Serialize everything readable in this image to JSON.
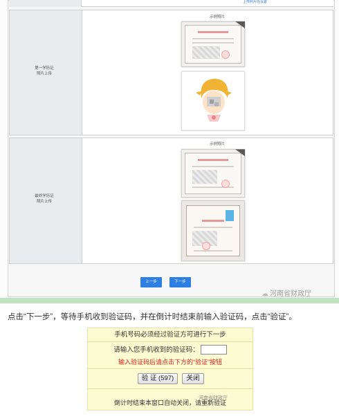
{
  "top_fragment": {
    "link": "上传照片任设置"
  },
  "section1": {
    "label_line1": "第一学历证",
    "label_line2": "照片上传",
    "caption": "示例照片"
  },
  "section2": {
    "label_line1": "最终学历证",
    "label_line2": "照片上传",
    "caption": "示例照片"
  },
  "nav": {
    "prev": "上一步",
    "next": "下一步"
  },
  "watermark": "河南省财政厅",
  "instruction": "点击“下一步”，等待手机收到验证码，并在倒计时结束前输入验证码，点击“验证”。",
  "verify_dialog": {
    "header": "手机号码必须经过验证方可进行下一步",
    "prompt": "请输入您手机收到的验证码：",
    "hint": "输入验证码后请点击下方的“验证”按钮",
    "verify_button": "验 证 (597)",
    "close_button": "关闭",
    "footer": "倒计时结束本窗口自动关闭，请重新验证",
    "watermark": "河南省财政厅"
  },
  "colors": {
    "accent": "#2d7fe3",
    "dialog_bg": "#fdfbd2",
    "hint_red": "#e02020",
    "green_bar": "#bfe3bf"
  }
}
